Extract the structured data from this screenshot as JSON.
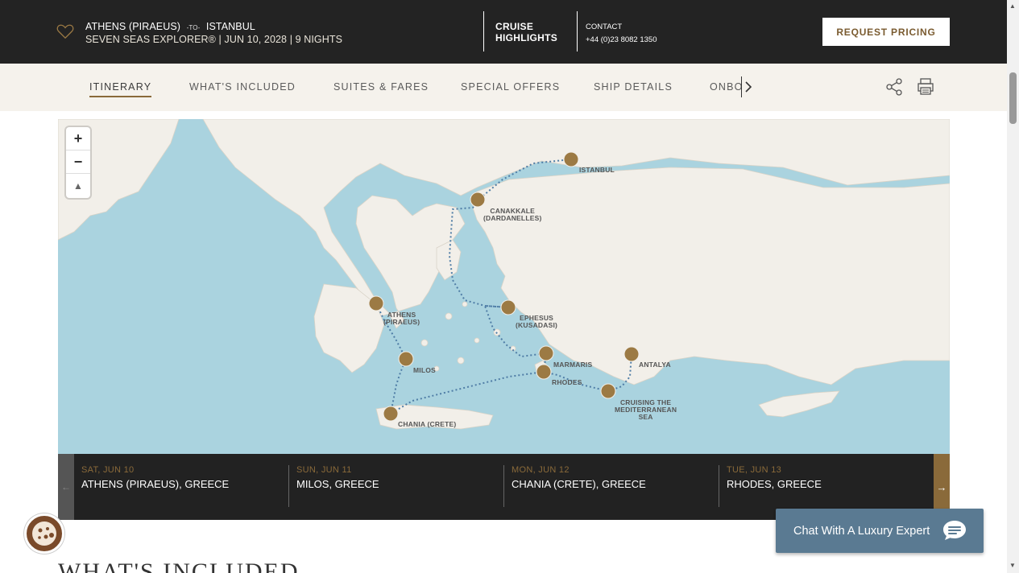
{
  "header": {
    "route_from": "ATHENS (PIRAEUS)",
    "route_to_word": "-TO-",
    "route_to": "ISTANBUL",
    "ship": "SEVEN SEAS EXPLORER®",
    "date": "JUN 10, 2028",
    "nights": "9 NIGHTS",
    "highlights_line1": "CRUISE",
    "highlights_line2": "HIGHLIGHTS",
    "contact_label": "CONTACT",
    "contact_phone": "+44 (0)23 8082 1350",
    "request_button": "REQUEST PRICING"
  },
  "nav": {
    "tabs": [
      {
        "label": "ITINERARY",
        "active": true
      },
      {
        "label": "WHAT'S INCLUDED"
      },
      {
        "label": "SUITES & FARES"
      },
      {
        "label": "SPECIAL OFFERS"
      },
      {
        "label": "SHIP DETAILS"
      },
      {
        "label": "ONBOARD"
      }
    ],
    "icons": [
      "share-icon",
      "print-icon"
    ]
  },
  "map": {
    "zoom_in": "+",
    "zoom_out": "−",
    "compass": "▲",
    "ports": [
      {
        "label": "ISTANBUL"
      },
      {
        "label": "CANAKKALE",
        "label2": "(DARDANELLES)"
      },
      {
        "label": "ATHENS",
        "label2": "(PIRAEUS)"
      },
      {
        "label": "EPHESUS",
        "label2": "(KUSADASI)"
      },
      {
        "label": "MILOS"
      },
      {
        "label": "MARMARIS"
      },
      {
        "label": "RHODES"
      },
      {
        "label": "ANTALYA"
      },
      {
        "label": "CRUISING THE",
        "label2": "MEDITERRANEAN",
        "label3": "SEA"
      },
      {
        "label": "CHANIA (CRETE)"
      }
    ],
    "colors": {
      "marker": "#9c7a44",
      "route": "#4f7da6",
      "sea": "#aad3df",
      "land": "#f2efe9"
    }
  },
  "itinerary": {
    "prev_arrow": "←",
    "next_arrow": "→",
    "days": [
      {
        "date": "SAT, JUN 10",
        "port": "ATHENS (PIRAEUS), GREECE"
      },
      {
        "date": "SUN, JUN 11",
        "port": "MILOS, GREECE"
      },
      {
        "date": "MON, JUN 12",
        "port": "CHANIA (CRETE), GREECE"
      },
      {
        "date": "TUE, JUN 13",
        "port": "RHODES, GREECE"
      }
    ]
  },
  "chat": {
    "label": "Chat With A Luxury Expert"
  },
  "section": {
    "title": "WHAT'S INCLUDED"
  }
}
